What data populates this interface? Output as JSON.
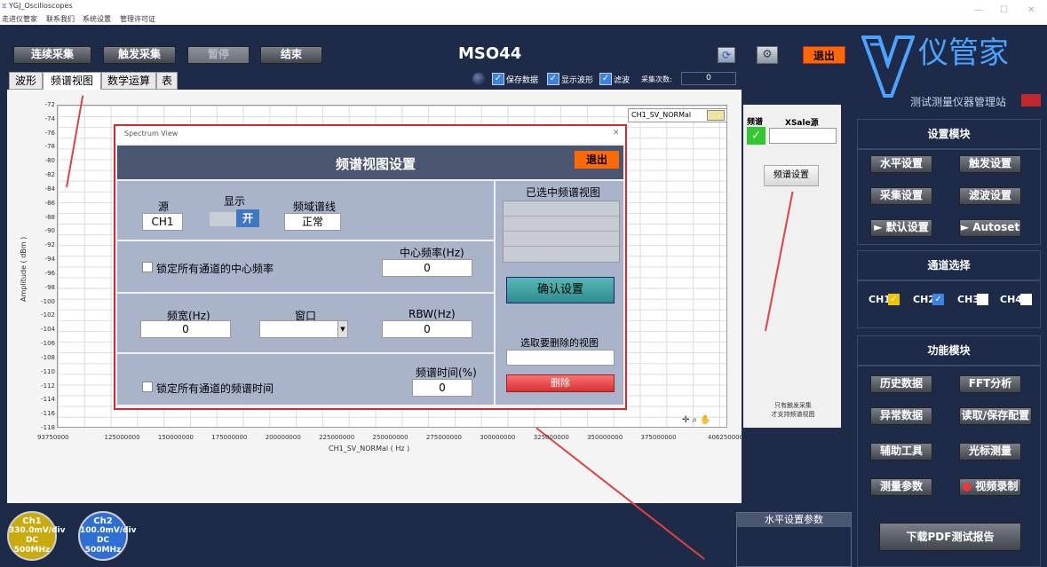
{
  "window": {
    "title": "YGJ_Oscilloscopes",
    "menu": [
      "走进仪管家",
      "联系我们",
      "系统设置",
      "管理许可证"
    ]
  },
  "toolbar": {
    "continuous": "连续采集",
    "trigger": "触发采集",
    "pause": "暂停",
    "stop": "结束",
    "model": "MSO44",
    "exit": "退出"
  },
  "status": {
    "save_data": "保存数据",
    "show_wave": "显示波形",
    "filter": "滤波",
    "acq_count_label": "采集次数:",
    "acq_count": "0"
  },
  "tabs": [
    "波形",
    "频谱视图",
    "数学运算",
    "表"
  ],
  "chart_data": {
    "type": "line",
    "title": "",
    "xlabel": "CH1_SV_NORMal ( Hz )",
    "ylabel": "Amplitude ( dBm )",
    "legend": "CH1_SV_NORMal",
    "xlim": [
      93750000,
      406250000
    ],
    "ylim": [
      -118,
      -72
    ],
    "x_ticks": [
      "93750000",
      "125000000",
      "150000000",
      "175000000",
      "200000000",
      "225000000",
      "250000000",
      "275000000",
      "300000000",
      "325000000",
      "350000000",
      "375000000",
      "406250000"
    ],
    "y_ticks": [
      "-72",
      "-74",
      "-76",
      "-78",
      "-80",
      "-82",
      "-84",
      "-86",
      "-88",
      "-90",
      "-92",
      "-94",
      "-96",
      "-98",
      "-100",
      "-102",
      "-104",
      "-106",
      "-108",
      "-110",
      "-112",
      "-114",
      "-116",
      "-118"
    ],
    "series": []
  },
  "side_mid": {
    "spectrum_label": "频谱",
    "xsale_label": "XSale源",
    "spectrum_setup": "频谱设置",
    "note": "只有触发采集\n才支持频谱视图",
    "horiz_params": "水平设置参数"
  },
  "dialog": {
    "window_title": "Spectrum View",
    "header": "频谱视图设置",
    "exit": "退出",
    "source_label": "源",
    "source_value": "CH1",
    "display_label": "显示",
    "display_value": "开",
    "line_label": "频域谱线",
    "line_value": "正常",
    "lock_center": "锁定所有通道的中心频率",
    "center_label": "中心频率(Hz)",
    "center_value": "0",
    "span_label": "频宽(Hz)",
    "span_value": "0",
    "window_label": "窗口",
    "window_value": "",
    "rbw_label": "RBW(Hz)",
    "rbw_value": "0",
    "lock_time": "锁定所有通道的频谱时间",
    "time_label": "频谱时间(%)",
    "time_value": "0",
    "selected_views": "已选中频谱视图",
    "confirm": "确认设置",
    "choose_delete": "选取要删除的视图",
    "delete": "删除"
  },
  "brand": {
    "name": "仪管家",
    "slogan": "测试测量仪器管理站"
  },
  "settings": {
    "title": "设置模块",
    "horizontal": "水平设置",
    "trigger": "触发设置",
    "acquire": "采集设置",
    "filter": "滤波设置",
    "default": "默认设置",
    "autoset": "Autoset"
  },
  "channels": {
    "title": "通道选择",
    "items": [
      "CH1",
      "CH2",
      "CH3",
      "CH4"
    ]
  },
  "functions": {
    "title": "功能模块",
    "history": "历史数据",
    "fft": "FFT分析",
    "abnormal": "异常数据",
    "rw_config": "读取/保存配置",
    "tools": "辅助工具",
    "cursor": "光标测量",
    "measure": "测量参数",
    "record": "视频录制",
    "pdf": "下载PDF测试报告"
  },
  "badges": [
    {
      "name": "Ch1",
      "scale": "330.0mV/div",
      "coupling": "DC",
      "bw": "500MHz",
      "color": "#c9ab0f"
    },
    {
      "name": "Ch2",
      "scale": "100.0mV/div",
      "coupling": "DC",
      "bw": "500MHz",
      "color": "#2f6fd3"
    }
  ]
}
